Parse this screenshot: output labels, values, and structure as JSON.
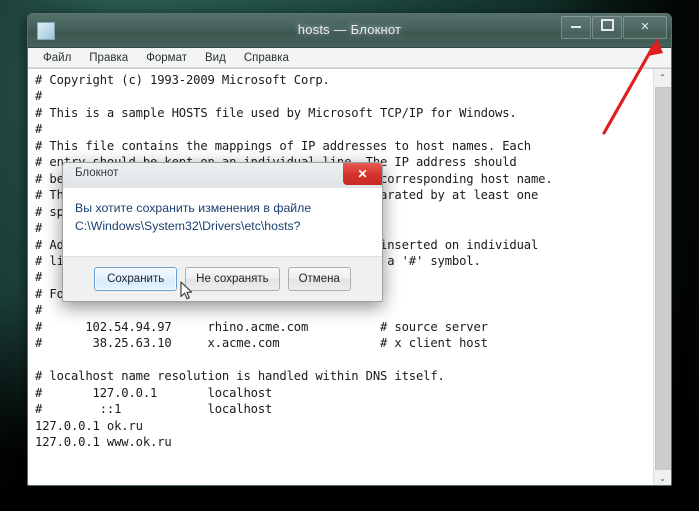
{
  "window": {
    "title": "hosts — Блокнот",
    "app_icon": "notepad-document-icon",
    "controls": {
      "minimize": "—",
      "maximize": "□",
      "close": "✕"
    }
  },
  "menubar": {
    "items": [
      {
        "label": "Файл"
      },
      {
        "label": "Правка"
      },
      {
        "label": "Формат"
      },
      {
        "label": "Вид"
      },
      {
        "label": "Справка"
      }
    ]
  },
  "editor": {
    "content": "# Copyright (c) 1993-2009 Microsoft Corp.\n#\n# This is a sample HOSTS file used by Microsoft TCP/IP for Windows.\n#\n# This file contains the mappings of IP addresses to host names. Each\n# entry should be kept on an individual line. The IP address should\n# be placed in the first column followed by the corresponding host name.\n# The IP address and the host name should be separated by at least one\n# space.\n#\n# Additionally, comments (such as these) may be inserted on individual\n# lines or following the machine name denoted by a '#' symbol.\n#\n# For example:\n#\n#      102.54.94.97     rhino.acme.com          # source server\n#       38.25.63.10     x.acme.com              # x client host\n\n# localhost name resolution is handled within DNS itself.\n#       127.0.0.1       localhost\n#        ::1            localhost\n127.0.0.1 ok.ru\n127.0.0.1 www.ok.ru"
  },
  "scrollbar": {
    "up_arrow": "⌃",
    "down_arrow": "⌄"
  },
  "dialog": {
    "title": "Блокнот",
    "close_label": "✕",
    "message_line1": "Вы хотите сохранить изменения в файле",
    "message_line2": "C:\\Windows\\System32\\Drivers\\etc\\hosts?",
    "buttons": [
      {
        "label": "Сохранить",
        "primary": true
      },
      {
        "label": "Не сохранять",
        "primary": false
      },
      {
        "label": "Отмена",
        "primary": false
      }
    ]
  },
  "annotation": {
    "arrow_color": "#e02020",
    "points_to": "window-close-button"
  },
  "colors": {
    "titlebar": "#44605b",
    "dialog_close_red": "#d4342c",
    "dialog_text_blue": "#1b3f72",
    "desktop": "#1f4a43"
  }
}
